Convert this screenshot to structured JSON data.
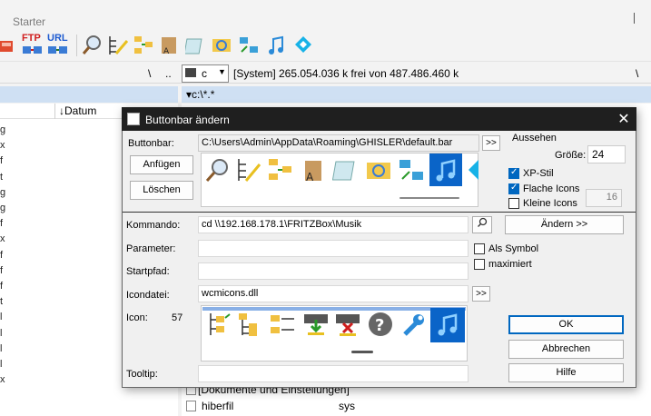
{
  "app": {
    "title": "Starter"
  },
  "pathbar": {
    "sep1": "\\",
    "sep2": "..",
    "sep3": "\\",
    "drive": "c",
    "free_space": "[System]  265.054.036 k frei von 487.486.460 k"
  },
  "toolbar": {
    "ftp_label": "FTP",
    "url_label": "URL"
  },
  "left_panel": {
    "column_header": "↓Datum",
    "row_chars": [
      "g",
      "x",
      "f",
      "t",
      "g",
      "g",
      "f",
      "x",
      "f",
      "f",
      "f",
      "t",
      "l",
      "l",
      "l",
      "l",
      "x"
    ]
  },
  "right_panel": {
    "path": "▾c:\\*.*",
    "rows": [
      {
        "name": "[Dokumente und Einstellungen]",
        "ext": ""
      },
      {
        "name": "hiberfil",
        "ext": "sys"
      }
    ]
  },
  "dialog": {
    "title": "Buttonbar ändern",
    "close_glyph": "✕",
    "buttonbar_label": "Buttonbar:",
    "buttonbar_path": "C:\\Users\\Admin\\AppData\\Roaming\\GHISLER\\default.bar",
    "browse_label": ">>",
    "append_label": "Anfügen",
    "delete_label": "Löschen",
    "appearance_group": "Aussehen",
    "size_label": "Größe:",
    "size_value": "24",
    "xp_style_label": "XP-Stil",
    "flat_icons_label": "Flache Icons",
    "small_icons_label": "Kleine Icons",
    "small_icons_size": "16",
    "command_label": "Kommando:",
    "command_value": "cd \\\\192.168.178.1\\FRITZBox\\Musik",
    "change_label": "Ändern >>",
    "parameter_label": "Parameter:",
    "as_symbol_label": "Als Symbol",
    "maximized_label": "maximiert",
    "startpath_label": "Startpfad:",
    "iconfile_label": "Icondatei:",
    "iconfile_value": "wcmicons.dll",
    "icon_label": "Icon:",
    "icon_index": "57",
    "ok_label": "OK",
    "cancel_label": "Abbrechen",
    "help_label": "Hilfe",
    "tooltip_label": "Tooltip:"
  },
  "colors": {
    "accent": "#0067c0",
    "selected_icon_bg": "#0a64c8",
    "title_bar": "#1f1f1f",
    "panel_header": "#cfe0f3"
  }
}
